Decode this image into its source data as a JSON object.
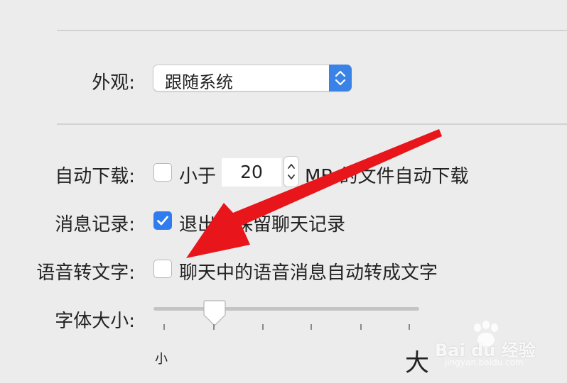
{
  "appearance": {
    "label": "外观:",
    "value": "跟随系统"
  },
  "auto_download": {
    "label": "自动下载:",
    "checked": false,
    "prefix": "小于",
    "size_value": "20",
    "suffix": "MB 的文件自动下载"
  },
  "message_history": {
    "label": "消息记录:",
    "checked": true,
    "text": "退出时保留聊天记录"
  },
  "voice_to_text": {
    "label": "语音转文字:",
    "checked": false,
    "text": "聊天中的语音消息自动转成文字"
  },
  "font_size": {
    "label": "字体大小:",
    "min_label": "小",
    "max_label": "大",
    "level": 0.23
  },
  "watermark": {
    "brand": "Bai du 经验",
    "url": "jingyan.baidu.com"
  },
  "colors": {
    "accent": "#2f7bf0",
    "annotation_arrow": "#e8151b"
  }
}
